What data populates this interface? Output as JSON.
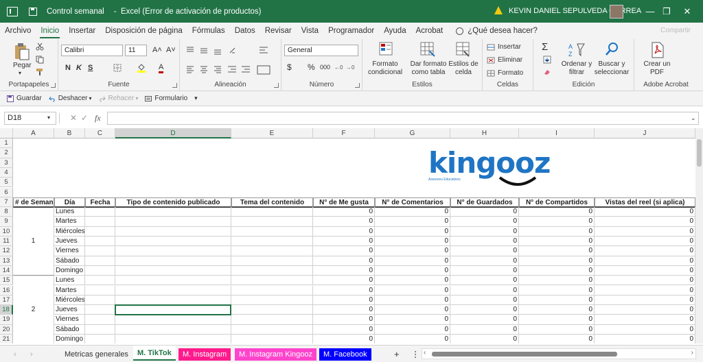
{
  "titlebar": {
    "file": "Control semanal",
    "app": "Excel (Error de activación de productos)",
    "user": "KEVIN DANIEL SEPULVEDA CORREA",
    "minimize": "—",
    "restore": "❐",
    "close": "✕"
  },
  "menu": {
    "tabs": [
      "Archivo",
      "Inicio",
      "Insertar",
      "Disposición de página",
      "Fórmulas",
      "Datos",
      "Revisar",
      "Vista",
      "Programador",
      "Ayuda",
      "Acrobat"
    ],
    "active": "Inicio",
    "tell_me": "¿Qué desea hacer?",
    "share": "Compartir"
  },
  "ribbon": {
    "clipboard": {
      "paste": "Pegar",
      "label": "Portapapeles"
    },
    "font": {
      "name": "Calibri",
      "size": "11",
      "grow": "A˄",
      "shrink": "A˅",
      "bold": "N",
      "italic": "K",
      "underline": "S",
      "color": "A",
      "label": "Fuente"
    },
    "alignment": {
      "label": "Alineación"
    },
    "number": {
      "format": "General",
      "currency": "$",
      "percent": "%",
      "thousands": "000",
      "label": "Número"
    },
    "styles": {
      "conditional": "Formato condicional",
      "table": "Dar formato como tabla",
      "cell_styles": "Estilos de celda",
      "label": "Estilos"
    },
    "cells": {
      "insert": "Insertar",
      "delete": "Eliminar",
      "format": "Formato",
      "label": "Celdas"
    },
    "editing": {
      "sum": "Σ",
      "sort": "Ordenar y filtrar",
      "find": "Buscar y seleccionar",
      "label": "Edición"
    },
    "acrobat": {
      "create": "Crear un PDF",
      "label": "Adobe Acrobat"
    }
  },
  "qat": {
    "save": "Guardar",
    "undo": "Deshacer",
    "redo": "Rehacer",
    "form": "Formulario"
  },
  "formula_bar": {
    "name_box": "D18",
    "fx": "fx",
    "content": ""
  },
  "columns": [
    "A",
    "B",
    "C",
    "D",
    "E",
    "F",
    "G",
    "H",
    "I",
    "J"
  ],
  "selected_column": "D",
  "rows": [
    "1",
    "2",
    "3",
    "4",
    "5",
    "6",
    "7",
    "8",
    "9",
    "10",
    "11",
    "12",
    "13",
    "14",
    "15",
    "16",
    "17",
    "18",
    "19",
    "20",
    "21"
  ],
  "selected_row": "18",
  "logo": {
    "text": "kingooz",
    "tagline": "Asesores Educativos"
  },
  "table": {
    "headers": [
      "# de Semana",
      "Día",
      "Fecha",
      "Tipo de contenido publicado",
      "Tema del contenido",
      "N° de Me gusta",
      "N° de Comentarios",
      "N° de Guardados",
      "N° de Compartidos",
      "Vistas del reel (si aplica)"
    ],
    "days": [
      "Lunes",
      "Martes",
      "Miércoles",
      "Jueves",
      "Viernes",
      "Sábado",
      "Domingo"
    ],
    "weeks": [
      "1",
      "2"
    ],
    "zero": "0"
  },
  "sheets": {
    "tabs": [
      "Metricas generales",
      "M. TikTok",
      "M. Instagram",
      "M. Instagram Kingooz",
      "M. Facebook"
    ],
    "active": "M. TikTok",
    "add": "+"
  },
  "colors": {
    "excel_green": "#217346",
    "instagram_tab": "#ff1b8d",
    "kingooz_tab": "#ff44cc",
    "facebook_tab": "#0000ff",
    "logo_blue": "#1f75c4"
  }
}
